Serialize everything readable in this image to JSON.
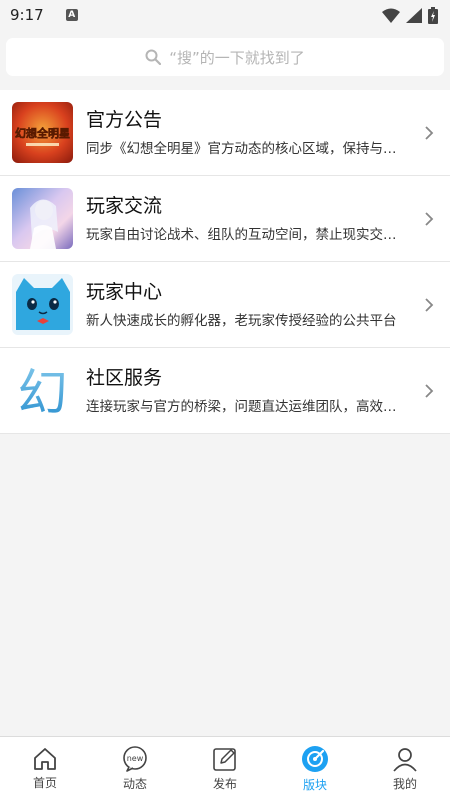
{
  "status_bar": {
    "time": "9:17",
    "notification_letter": "A"
  },
  "search": {
    "placeholder": "“搜”的一下就找到了"
  },
  "boards": [
    {
      "title": "官方公告",
      "description": "同步《幻想全明星》官方动态的核心区域，保持与官方同步更新",
      "icon": "game-logo-image",
      "logo_text": "幻想全明星"
    },
    {
      "title": "玩家交流",
      "description": "玩家自由讨论战术、组队的互动空间，禁止现实交易行为",
      "icon": "anime-character-image"
    },
    {
      "title": "玩家中心",
      "description": "新人快速成长的孵化器，老玩家传授经验的公共平台",
      "icon": "blue-cat-mascot-image"
    },
    {
      "title": "社区服务",
      "description": "连接玩家与官方的桥梁，问题直达运维团队，高效解决",
      "icon": "huan-character-logo",
      "logo_text": "幻"
    }
  ],
  "tabs": [
    {
      "label": "首页",
      "icon": "home-icon",
      "active": false
    },
    {
      "label": "动态",
      "icon": "new-bubble-icon",
      "active": false,
      "icon_text": "new"
    },
    {
      "label": "发布",
      "icon": "edit-icon",
      "active": false
    },
    {
      "label": "版块",
      "icon": "compass-icon",
      "active": true
    },
    {
      "label": "我的",
      "icon": "profile-icon",
      "active": false
    }
  ],
  "colors": {
    "accent": "#1da1f2",
    "background": "#f4f4f4",
    "divider": "#e6e6e6"
  }
}
